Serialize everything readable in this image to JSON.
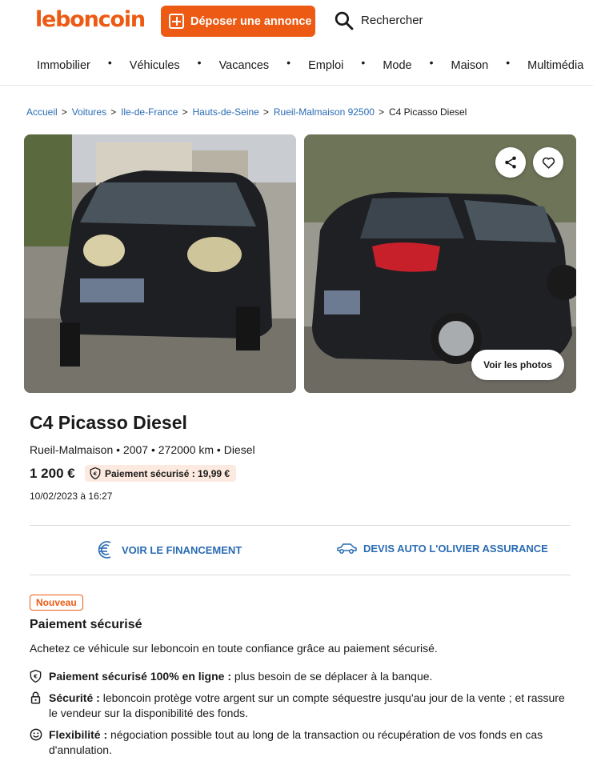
{
  "header": {
    "logo": "leboncoin",
    "deposit_label": "Déposer une annonce",
    "search_label": "Rechercher",
    "nav": [
      "Immobilier",
      "Véhicules",
      "Vacances",
      "Emploi",
      "Mode",
      "Maison",
      "Multimédia"
    ]
  },
  "breadcrumb": {
    "items": [
      "Accueil",
      "Voitures",
      "Ile-de-France",
      "Hauts-de-Seine",
      "Rueil-Malmaison 92500"
    ],
    "current": "C4 Picasso Diesel"
  },
  "gallery": {
    "voir_photos_label": "Voir les photos"
  },
  "ad": {
    "title": "C4 Picasso Diesel",
    "subtitle": "Rueil-Malmaison • 2007 • 272000 km • Diesel",
    "price": "1 200 €",
    "payment_badge": "Paiement sécurisé : 19,99 €",
    "date": "10/02/2023 à 16:27"
  },
  "actions": {
    "financement": "VOIR LE FINANCEMENT",
    "devis": "DEVIS AUTO L'OLIVIER ASSURANCE"
  },
  "secure_payment": {
    "badge": "Nouveau",
    "title": "Paiement sécurisé",
    "description": "Achetez ce véhicule sur leboncoin en toute confiance grâce au paiement sécurisé.",
    "features": [
      {
        "title": "Paiement sécurisé 100% en ligne :",
        "text": " plus besoin de se déplacer à la banque."
      },
      {
        "title": "Sécurité :",
        "text": " leboncoin protège votre argent sur un compte séquestre jusqu'au jour de la vente ; et rassure le vendeur sur la disponibilité des fonds."
      },
      {
        "title": "Flexibilité :",
        "text": " négociation possible tout au long de la transaction ou récupération de vos fonds en cas d'annulation."
      }
    ]
  },
  "colors": {
    "brand": "#ec5a13",
    "link": "#2a6bb3",
    "badge_bg": "#fce9df"
  }
}
